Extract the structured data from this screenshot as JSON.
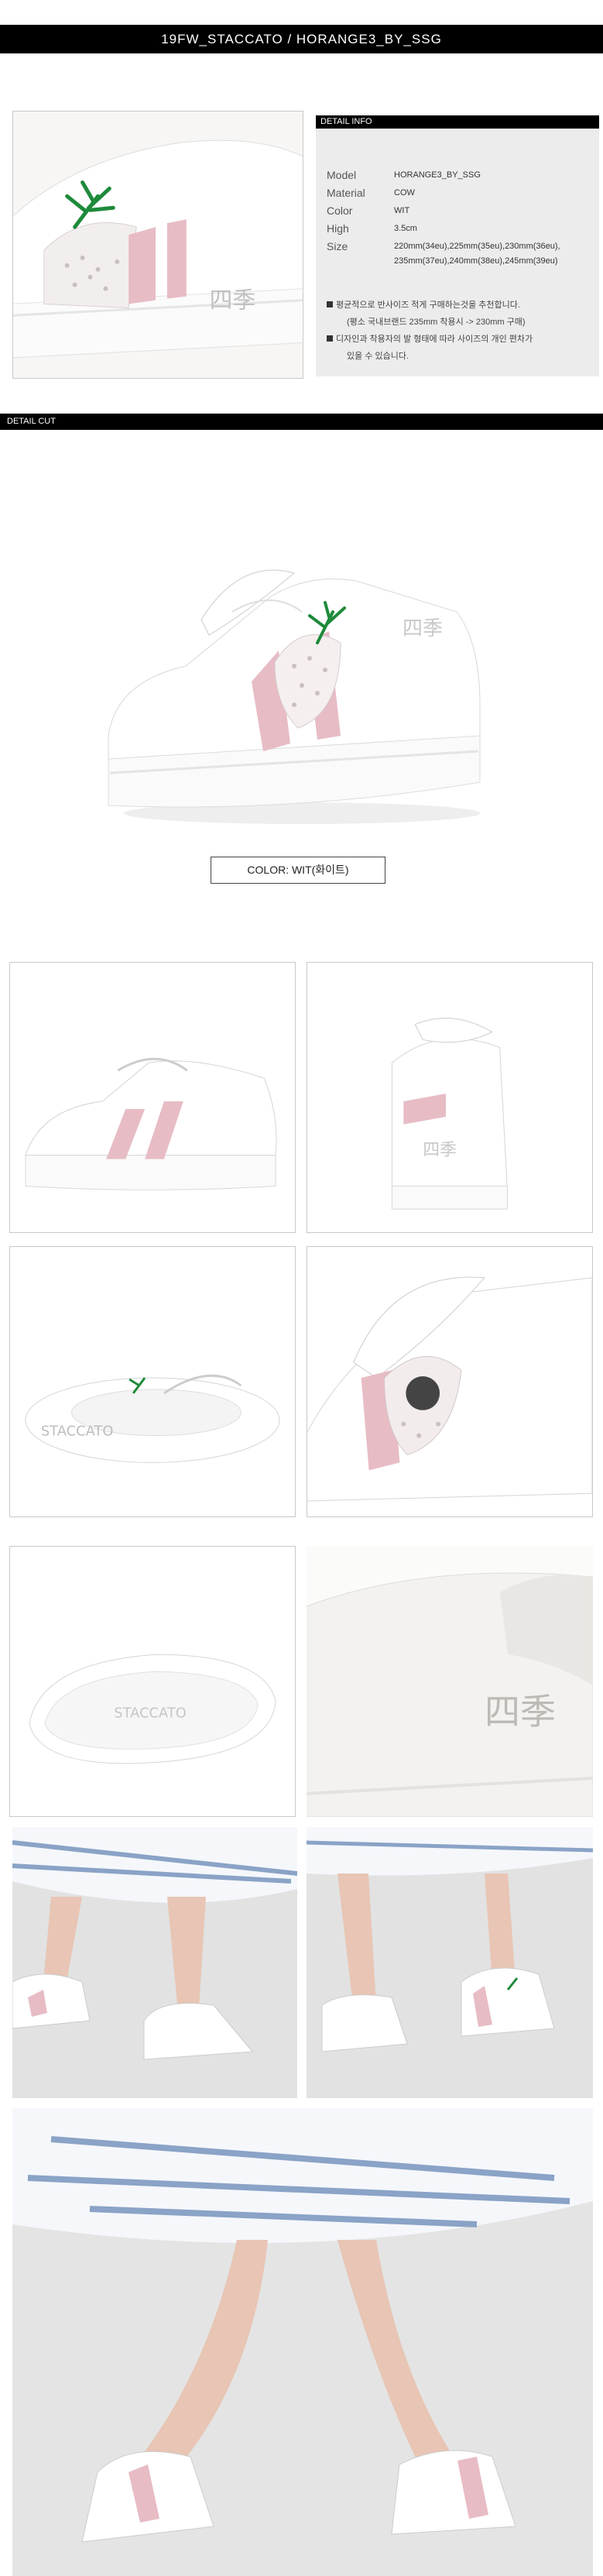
{
  "header": {
    "title": "19FW_STACCATO / HORANGE3_BY_SSG"
  },
  "detail_info": {
    "title": "DETAIL INFO",
    "specs": [
      {
        "label": "Model",
        "value": "HORANGE3_BY_SSG"
      },
      {
        "label": "Material",
        "value": "COW"
      },
      {
        "label": "Color",
        "value": "WIT"
      },
      {
        "label": "High",
        "value": "3.5cm"
      }
    ],
    "size_label": "Size",
    "size_lines": [
      "220mm(34eu),225mm(35eu),230mm(36eu),",
      "235mm(37eu),240mm(38eu),245mm(39eu)"
    ],
    "notes": [
      "평균적으로 반사이즈 적게 구매하는것을 추천합니다.",
      "(평소 국내브랜드 235mm 착용시 -> 230mm 구매)",
      "디자인과 착용자의 발 형태에 따라 사이즈의 개인 편차가",
      "있을 수 있습니다."
    ]
  },
  "detail_cut": {
    "title": "DETAIL CUT"
  },
  "color_label": "COLOR: WIT(화이트)",
  "icons": {
    "bullet": "square-bullet-icon"
  },
  "colors": {
    "bar": "#000000",
    "info_bg": "#ececec",
    "stripe_pink": "#e7bcc5",
    "leaf_green": "#1e8a3a"
  }
}
